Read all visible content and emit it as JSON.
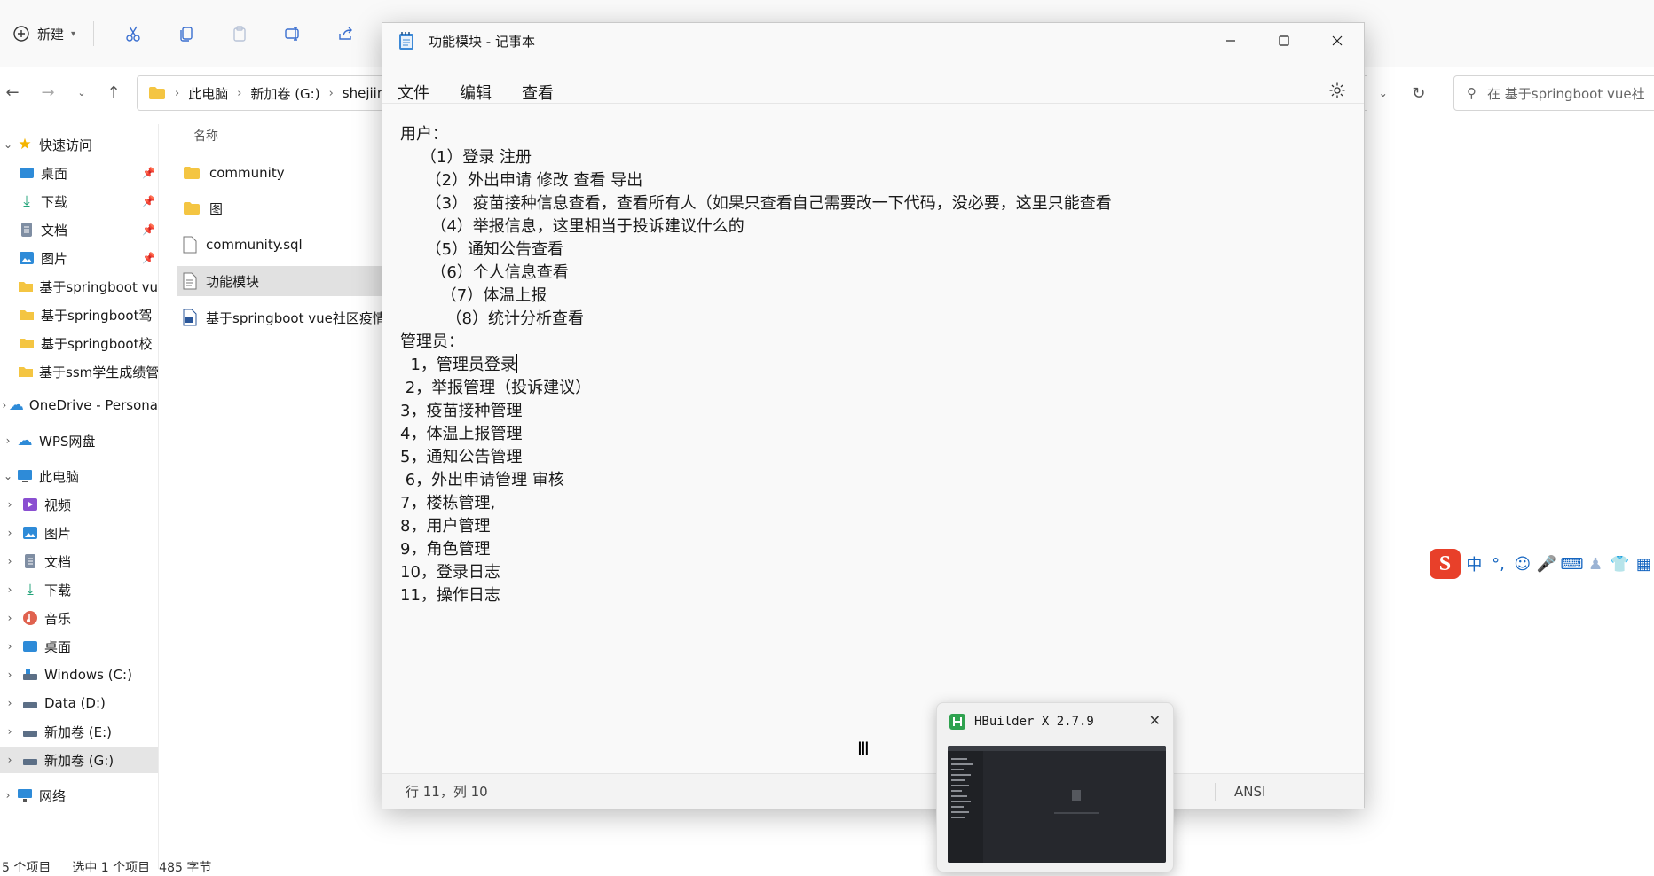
{
  "explorer": {
    "toolbar": {
      "new_label": "新建"
    },
    "address": {
      "crumbs": [
        "此电脑",
        "新加卷 (G:)",
        "shejiin"
      ],
      "search_placeholder": "在 基于springboot vue社"
    },
    "sidebar": {
      "quick_access": "快速访问",
      "quick_items": [
        "桌面",
        "下载",
        "文档",
        "图片"
      ],
      "folders": [
        "基于springboot vu",
        "基于springboot驾",
        "基于springboot校",
        "基于ssm学生成绩管"
      ],
      "onedrive": "OneDrive - Persona",
      "wps": "WPS网盘",
      "this_pc": "此电脑",
      "pc_items": [
        "视频",
        "图片",
        "文档",
        "下载",
        "音乐",
        "桌面",
        "Windows (C:)",
        "Data (D:)",
        "新加卷 (E:)",
        "新加卷 (G:)"
      ],
      "network": "网络"
    },
    "column_name": "名称",
    "files": [
      "community",
      "图",
      "community.sql",
      "功能模块",
      "基于springboot vue社区疫情"
    ],
    "status": {
      "count": "5 个项目",
      "selected": "选中 1 个项目",
      "size": "485 字节"
    }
  },
  "notepad": {
    "title": "功能模块 - 记事本",
    "menu": [
      "文件",
      "编辑",
      "查看"
    ],
    "lines": [
      "用户：",
      "    （1）登录 注册",
      "     （2）外出申请 修改 查看 导出",
      "     （3） 疫苗接种信息查看，查看所有人（如果只查看自己需要改一下代码，没必要，这里只能查看",
      "      （4）举报信息，这里相当于投诉建议什么的",
      "     （5）通知公告查看",
      "      （6）个人信息查看",
      "        （7）体温上报",
      "         （8）统计分析查看",
      "管理员：",
      "  1，管理员登录",
      " 2，举报管理（投诉建议）",
      "3，疫苗接种管理",
      "4，体温上报管理",
      "5，通知公告管理",
      " 6，外出申请管理 审核",
      "7，楼栋管理,",
      "8，用户管理",
      "9，角色管理",
      "10，登录日志",
      "11，操作日志"
    ],
    "status": {
      "position": "行 11，列 10",
      "encoding": "ANSI"
    }
  },
  "thumbnail": {
    "title": "HBuilder X 2.7.9"
  },
  "ime": {
    "mode": "中",
    "punct": "°,"
  }
}
